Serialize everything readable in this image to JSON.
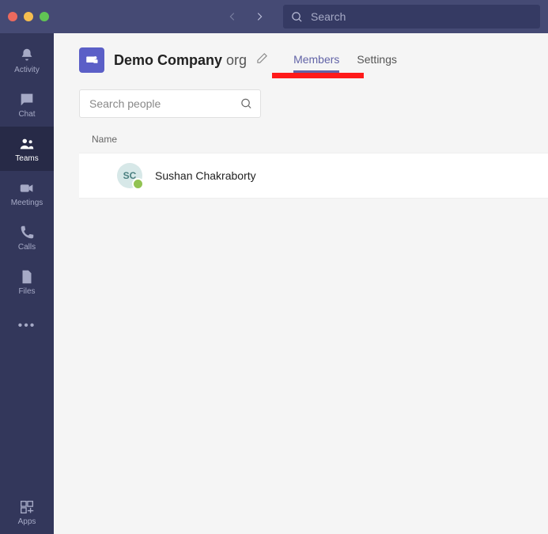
{
  "titlebar": {
    "search_placeholder": "Search"
  },
  "rail": {
    "items": [
      {
        "label": "Activity"
      },
      {
        "label": "Chat"
      },
      {
        "label": "Teams"
      },
      {
        "label": "Meetings"
      },
      {
        "label": "Calls"
      },
      {
        "label": "Files"
      }
    ],
    "apps_label": "Apps"
  },
  "header": {
    "org_name": "Demo Company",
    "org_suffix": " org"
  },
  "tabs": [
    {
      "label": "Members",
      "active": true
    },
    {
      "label": "Settings",
      "active": false
    }
  ],
  "search_people_placeholder": "Search people",
  "columns": {
    "name": "Name"
  },
  "members": [
    {
      "initials": "SC",
      "name": "Sushan Chakraborty",
      "presence": "available"
    }
  ]
}
